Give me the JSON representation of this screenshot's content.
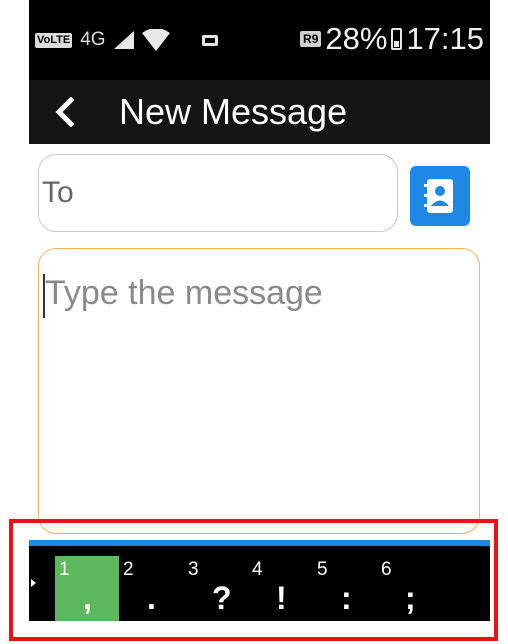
{
  "status_bar": {
    "volte": "VoLTE",
    "network": "4G",
    "roaming": "R9",
    "battery": "28%",
    "time": "17:15"
  },
  "app_bar": {
    "title": "New Message"
  },
  "to_field": {
    "placeholder": "To"
  },
  "message": {
    "placeholder": "Type the message"
  },
  "symbol_bar": {
    "keys": [
      {
        "num": "1",
        "sym": ","
      },
      {
        "num": "2",
        "sym": "."
      },
      {
        "num": "3",
        "sym": "?"
      },
      {
        "num": "4",
        "sym": "!"
      },
      {
        "num": "5",
        "sym": ":"
      },
      {
        "num": "6",
        "sym": ";"
      }
    ]
  },
  "colors": {
    "accent": "#1e88e5",
    "selected_key": "#5cb85c",
    "message_border": "#f1b25a",
    "highlight": "#ee1111"
  }
}
